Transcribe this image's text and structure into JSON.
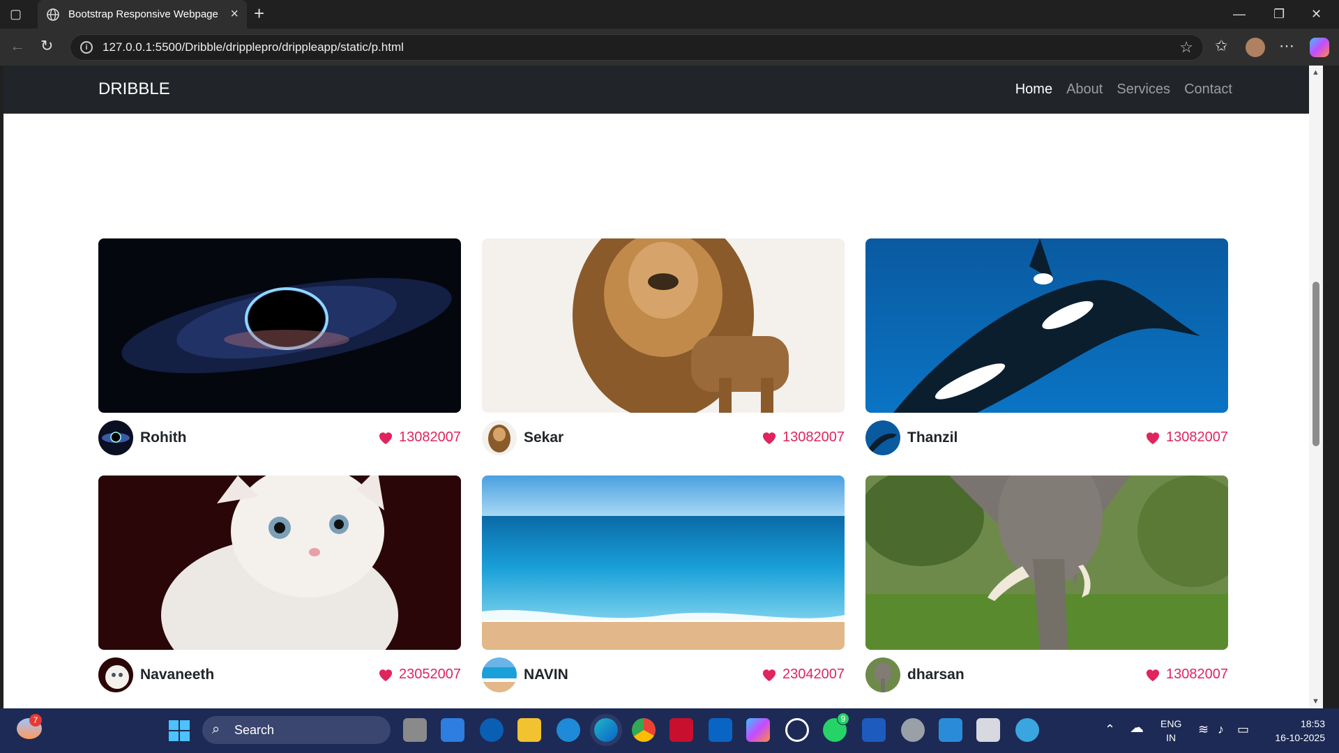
{
  "browser": {
    "tab_title": "Bootstrap Responsive Webpage",
    "url": "127.0.0.1:5500/Dribble/dripplepro/drippleapp/static/p.html"
  },
  "site": {
    "brand": "DRIBBLE",
    "nav": [
      {
        "label": "Home",
        "active": true
      },
      {
        "label": "About",
        "active": false
      },
      {
        "label": "Services",
        "active": false
      },
      {
        "label": "Contact",
        "active": false
      }
    ]
  },
  "cards": [
    {
      "name": "Rohith",
      "likes": "13082007",
      "image": "black-hole"
    },
    {
      "name": "Sekar",
      "likes": "13082007",
      "image": "lion"
    },
    {
      "name": "Thanzil",
      "likes": "13082007",
      "image": "orca"
    },
    {
      "name": "Navaneeth",
      "likes": "23052007",
      "image": "white-kitten"
    },
    {
      "name": "NAVIN",
      "likes": "23042007",
      "image": "beach"
    },
    {
      "name": "dharsan",
      "likes": "13082007",
      "image": "elephant"
    }
  ],
  "taskbar": {
    "search_label": "Search",
    "weather_badge": "7",
    "whatsapp_badge": "9",
    "lang_primary": "ENG",
    "lang_secondary": "IN",
    "time": "18:53",
    "date": "16-10-2025"
  },
  "colors": {
    "accent_like": "#e0245e",
    "navbar": "#212529"
  }
}
